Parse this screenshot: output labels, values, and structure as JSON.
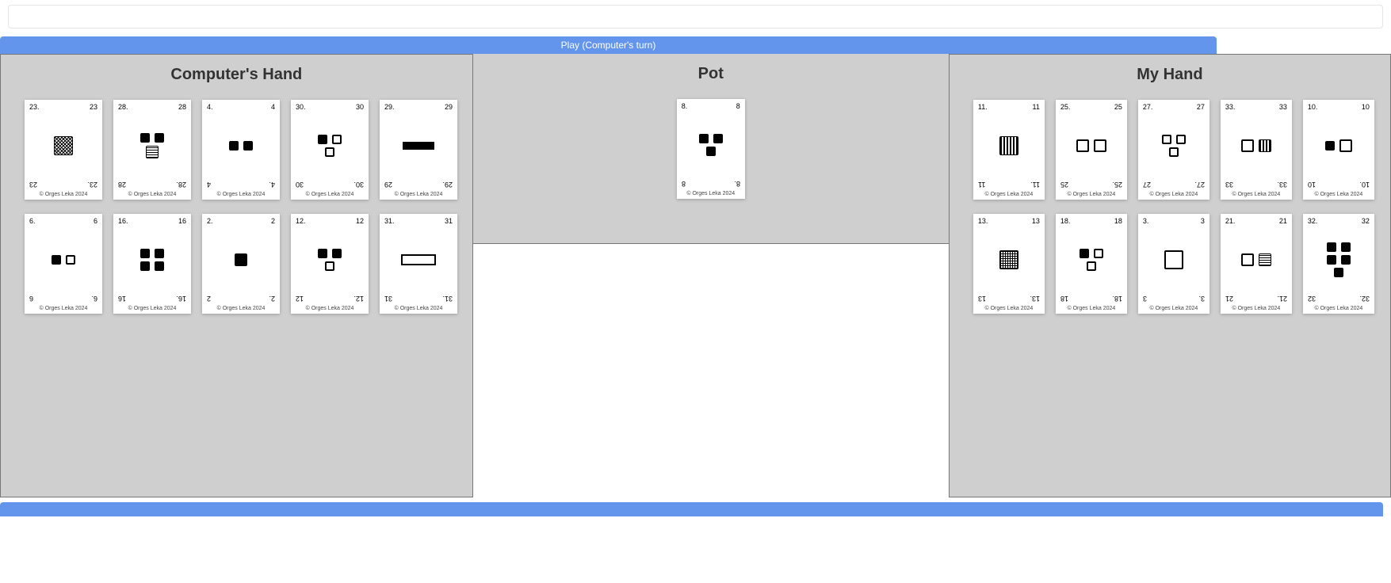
{
  "playButton": "Play (Computer's turn)",
  "headers": {
    "computer": "Computer's Hand",
    "pot": "Pot",
    "mine": "My Hand"
  },
  "copyright": "© Orges Leka 2024",
  "computer": [
    {
      "id": "23",
      "layout": "single",
      "shapes": [
        [
          "hatch",
          "big"
        ]
      ]
    },
    {
      "id": "28",
      "layout": "col2",
      "shapes_top": [
        [
          "filled",
          "small"
        ],
        [
          "filled",
          "small"
        ]
      ],
      "shapes_bot": [
        [
          "hstripe",
          "med"
        ]
      ]
    },
    {
      "id": "4",
      "layout": "row",
      "shapes": [
        [
          "filled",
          "small"
        ],
        [
          "filled",
          "small"
        ]
      ]
    },
    {
      "id": "30",
      "layout": "col2",
      "shapes_top": [
        [
          "filled",
          "small"
        ],
        [
          "empty",
          "small"
        ]
      ],
      "shapes_bot": [
        [
          "empty",
          "small"
        ]
      ]
    },
    {
      "id": "29",
      "layout": "single",
      "shapes": [
        [
          "filled",
          "rect"
        ]
      ]
    },
    {
      "id": "6",
      "layout": "row",
      "shapes": [
        [
          "filled",
          "small"
        ],
        [
          "empty",
          "small"
        ]
      ]
    },
    {
      "id": "16",
      "layout": "col2",
      "shapes_top": [
        [
          "filled",
          "small"
        ],
        [
          "filled",
          "small"
        ]
      ],
      "shapes_bot": [
        [
          "filled",
          "small"
        ],
        [
          "filled",
          "small"
        ]
      ]
    },
    {
      "id": "2",
      "layout": "single",
      "shapes": [
        [
          "filled",
          "med"
        ]
      ]
    },
    {
      "id": "12",
      "layout": "col2",
      "shapes_top": [
        [
          "filled",
          "small"
        ],
        [
          "filled",
          "small"
        ]
      ],
      "shapes_bot": [
        [
          "empty",
          "small"
        ]
      ]
    },
    {
      "id": "31",
      "layout": "single",
      "shapes": [
        [
          "empty",
          "rect"
        ]
      ]
    }
  ],
  "pot": [
    {
      "id": "8",
      "layout": "col2",
      "shapes_top": [
        [
          "filled",
          "small"
        ],
        [
          "filled",
          "small"
        ]
      ],
      "shapes_bot": [
        [
          "filled",
          "small"
        ]
      ]
    }
  ],
  "mine": [
    {
      "id": "11",
      "layout": "single",
      "shapes": [
        [
          "vstripe",
          "big"
        ]
      ]
    },
    {
      "id": "25",
      "layout": "row",
      "shapes": [
        [
          "empty",
          "med"
        ],
        [
          "empty",
          "med"
        ]
      ]
    },
    {
      "id": "27",
      "layout": "col2",
      "shapes_top": [
        [
          "empty",
          "small"
        ],
        [
          "empty",
          "small"
        ]
      ],
      "shapes_bot": [
        [
          "empty",
          "small"
        ]
      ]
    },
    {
      "id": "33",
      "layout": "row",
      "shapes": [
        [
          "empty",
          "med"
        ],
        [
          "vstripe",
          "med"
        ]
      ]
    },
    {
      "id": "10",
      "layout": "row",
      "shapes": [
        [
          "filled",
          "small"
        ],
        [
          "empty",
          "med"
        ]
      ]
    },
    {
      "id": "13",
      "layout": "single",
      "shapes": [
        [
          "grid",
          "big"
        ]
      ]
    },
    {
      "id": "18",
      "layout": "col2",
      "shapes_top": [
        [
          "filled",
          "small"
        ],
        [
          "empty",
          "small"
        ]
      ],
      "shapes_bot": [
        [
          "empty",
          "small"
        ]
      ]
    },
    {
      "id": "3",
      "layout": "single",
      "shapes": [
        [
          "empty",
          "big"
        ]
      ]
    },
    {
      "id": "21",
      "layout": "row",
      "shapes": [
        [
          "empty",
          "med"
        ],
        [
          "hstripe",
          "med"
        ]
      ]
    },
    {
      "id": "32",
      "layout": "col2",
      "shapes_top": [
        [
          "filled",
          "small"
        ],
        [
          "filled",
          "small"
        ]
      ],
      "shapes_row2": [
        [
          "filled",
          "small"
        ],
        [
          "filled",
          "small"
        ]
      ],
      "shapes_bot": [
        [
          "filled",
          "small"
        ]
      ]
    }
  ]
}
